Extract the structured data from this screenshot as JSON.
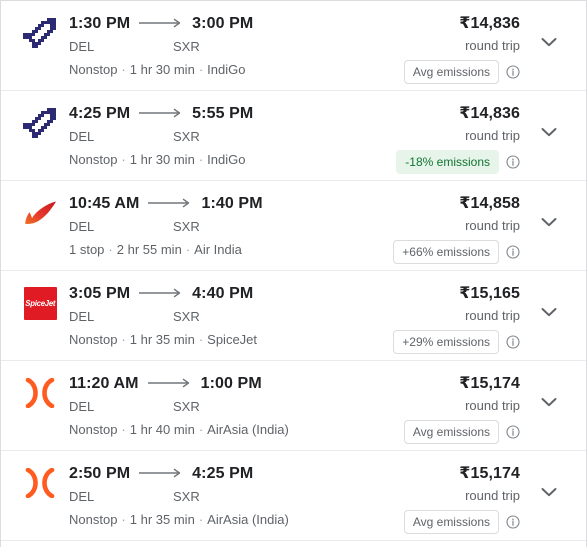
{
  "card": {
    "currency_symbol": "₹",
    "colors": {
      "indigo_blue": "#2b2a73",
      "airindia_red": "#e2342a",
      "spicejet_red": "#e01b24",
      "airasia_orange": "#ff5a1f",
      "low_emissions_bg": "#e6f4ea",
      "low_emissions_text": "#137333",
      "divider": "#e8eaed"
    },
    "icons": {
      "chevron": "chevron-down-icon",
      "info": "info-circle-icon",
      "arrow": "flight-arrow-icon"
    }
  },
  "flights": [
    {
      "airline": "IndiGo",
      "logo": "indigo",
      "depart_time": "1:30 PM",
      "arrive_time": "3:00 PM",
      "origin": "DEL",
      "destination": "SXR",
      "stops": "Nonstop",
      "duration": "1 hr 30 min",
      "price": "₹14,836",
      "trip_type": "round trip",
      "emissions_label": "Avg emissions",
      "emissions_style": "neutral"
    },
    {
      "airline": "IndiGo",
      "logo": "indigo",
      "depart_time": "4:25 PM",
      "arrive_time": "5:55 PM",
      "origin": "DEL",
      "destination": "SXR",
      "stops": "Nonstop",
      "duration": "1 hr 30 min",
      "price": "₹14,836",
      "trip_type": "round trip",
      "emissions_label": "-18% emissions",
      "emissions_style": "low"
    },
    {
      "airline": "Air India",
      "logo": "airindia",
      "depart_time": "10:45 AM",
      "arrive_time": "1:40 PM",
      "origin": "DEL",
      "destination": "SXR",
      "stops": "1 stop",
      "duration": "2 hr 55 min",
      "price": "₹14,858",
      "trip_type": "round trip",
      "emissions_label": "+66% emissions",
      "emissions_style": "neutral"
    },
    {
      "airline": "SpiceJet",
      "logo": "spicejet",
      "logo_text": "SpiceJet",
      "depart_time": "3:05 PM",
      "arrive_time": "4:40 PM",
      "origin": "DEL",
      "destination": "SXR",
      "stops": "Nonstop",
      "duration": "1 hr 35 min",
      "price": "₹15,165",
      "trip_type": "round trip",
      "emissions_label": "+29% emissions",
      "emissions_style": "neutral"
    },
    {
      "airline": "AirAsia (India)",
      "logo": "airasia",
      "depart_time": "11:20 AM",
      "arrive_time": "1:00 PM",
      "origin": "DEL",
      "destination": "SXR",
      "stops": "Nonstop",
      "duration": "1 hr 40 min",
      "price": "₹15,174",
      "trip_type": "round trip",
      "emissions_label": "Avg emissions",
      "emissions_style": "neutral"
    },
    {
      "airline": "AirAsia (India)",
      "logo": "airasia",
      "depart_time": "2:50 PM",
      "arrive_time": "4:25 PM",
      "origin": "DEL",
      "destination": "SXR",
      "stops": "Nonstop",
      "duration": "1 hr 35 min",
      "price": "₹15,174",
      "trip_type": "round trip",
      "emissions_label": "Avg emissions",
      "emissions_style": "neutral"
    }
  ]
}
